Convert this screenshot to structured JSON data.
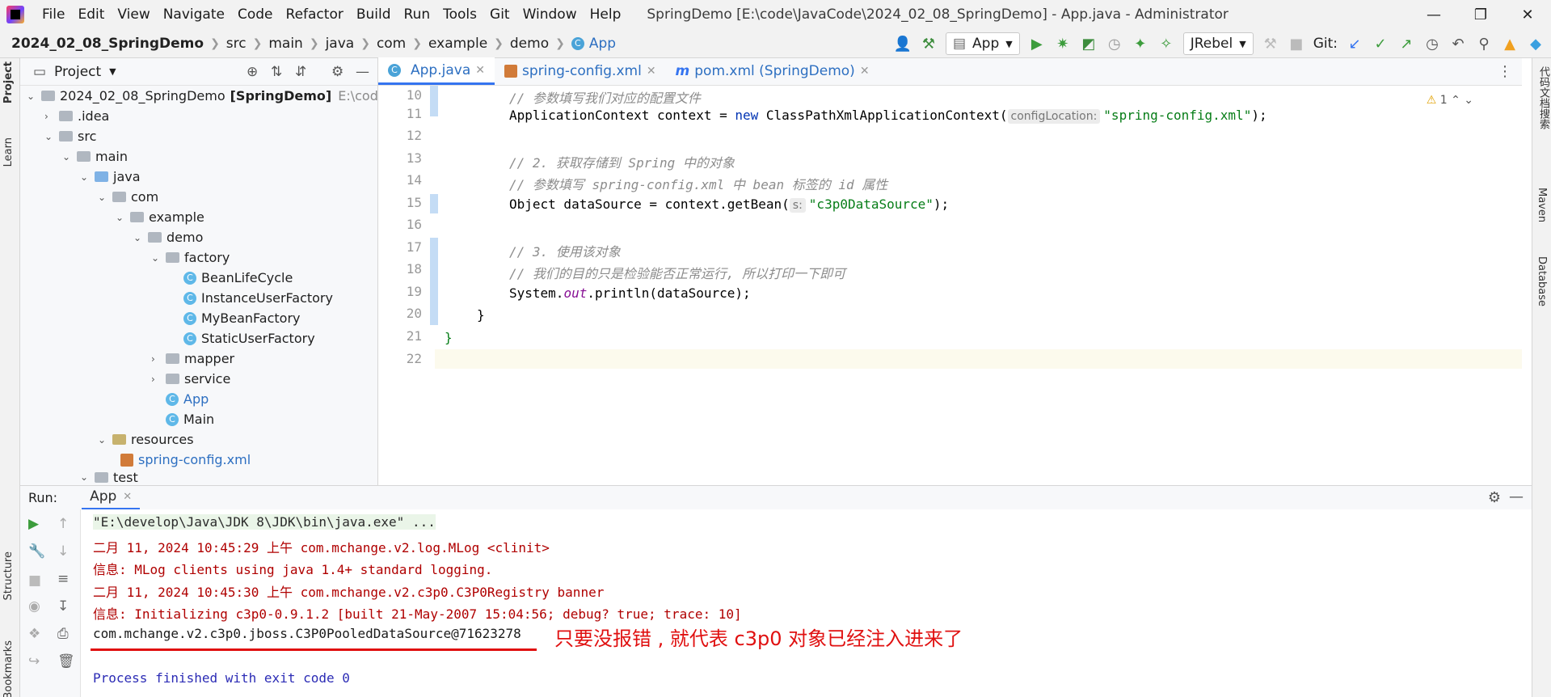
{
  "menubar": [
    "File",
    "Edit",
    "View",
    "Navigate",
    "Code",
    "Refactor",
    "Build",
    "Run",
    "Tools",
    "Git",
    "Window",
    "Help"
  ],
  "window_title": "SpringDemo [E:\\code\\JavaCode\\2024_02_08_SpringDemo] - App.java - Administrator",
  "breadcrumb": [
    "2024_02_08_SpringDemo",
    "src",
    "main",
    "java",
    "com",
    "example",
    "demo",
    "App"
  ],
  "toolbar": {
    "run_config": "App",
    "jrebel": "JRebel",
    "git_label": "Git:"
  },
  "left_stripe": {
    "project": "Project",
    "learn": "Learn",
    "structure": "Structure",
    "bookmarks": "Bookmarks"
  },
  "right_stripe": {
    "code_search": "代码文档搜索",
    "maven": "Maven",
    "database": "Database"
  },
  "project_panel": {
    "title": "Project",
    "root": {
      "name": "2024_02_08_SpringDemo",
      "module": "[SpringDemo]",
      "path": "E:\\code\\Java"
    },
    "items": [
      ".idea",
      "src",
      "main",
      "java",
      "com",
      "example",
      "demo",
      "factory",
      "BeanLifeCycle",
      "InstanceUserFactory",
      "MyBeanFactory",
      "StaticUserFactory",
      "mapper",
      "service",
      "App",
      "Main",
      "resources",
      "spring-config.xml",
      "test"
    ]
  },
  "editor": {
    "tabs": [
      "App.java",
      "spring-config.xml",
      "pom.xml (SpringDemo)"
    ],
    "warning_count": "1",
    "line_numbers": [
      "10",
      "11",
      "12",
      "13",
      "14",
      "15",
      "16",
      "17",
      "18",
      "19",
      "20",
      "21",
      "22"
    ],
    "lines": {
      "l10_comment": "// 参数填写我们对应的配置文件",
      "l11_type": "ApplicationContext context = ",
      "l11_new": "new",
      "l11_class": " ClassPathXmlApplicationContext(",
      "l11_hint": "configLocation:",
      "l11_arg": "\"spring-config.xml\"",
      "l11_end": ");",
      "l13_comment": "// 2. 获取存储到 Spring 中的对象",
      "l14_comment": "// 参数填写 spring-config.xml 中 bean 标签的 id 属性",
      "l15_code": "Object dataSource = context.getBean(",
      "l15_hint": "s:",
      "l15_arg": "\"c3p0DataSource\"",
      "l15_end": ");",
      "l17_comment": "// 3. 使用该对象",
      "l18_comment": "// 我们的目的只是检验能否正常运行, 所以打印一下即可",
      "l19_pre": "System.",
      "l19_field": "out",
      "l19_post": ".println(dataSource);",
      "l20_brace": "}",
      "l21_brace": "}"
    }
  },
  "run_panel": {
    "label": "Run:",
    "tab": "App",
    "console": [
      "\"E:\\develop\\Java\\JDK 8\\JDK\\bin\\java.exe\" ...",
      "二月 11, 2024 10:45:29 上午 com.mchange.v2.log.MLog <clinit>",
      "信息: MLog clients using java 1.4+ standard logging.",
      "二月 11, 2024 10:45:30 上午 com.mchange.v2.c3p0.C3P0Registry banner",
      "信息: Initializing c3p0-0.9.1.2 [built 21-May-2007 15:04:56; debug? true; trace: 10]",
      "com.mchange.v2.c3p0.jboss.C3P0PooledDataSource@71623278",
      "Process finished with exit code 0"
    ],
    "annotation": "只要没报错 , 就代表 c3p0 对象已经注入进来了"
  }
}
